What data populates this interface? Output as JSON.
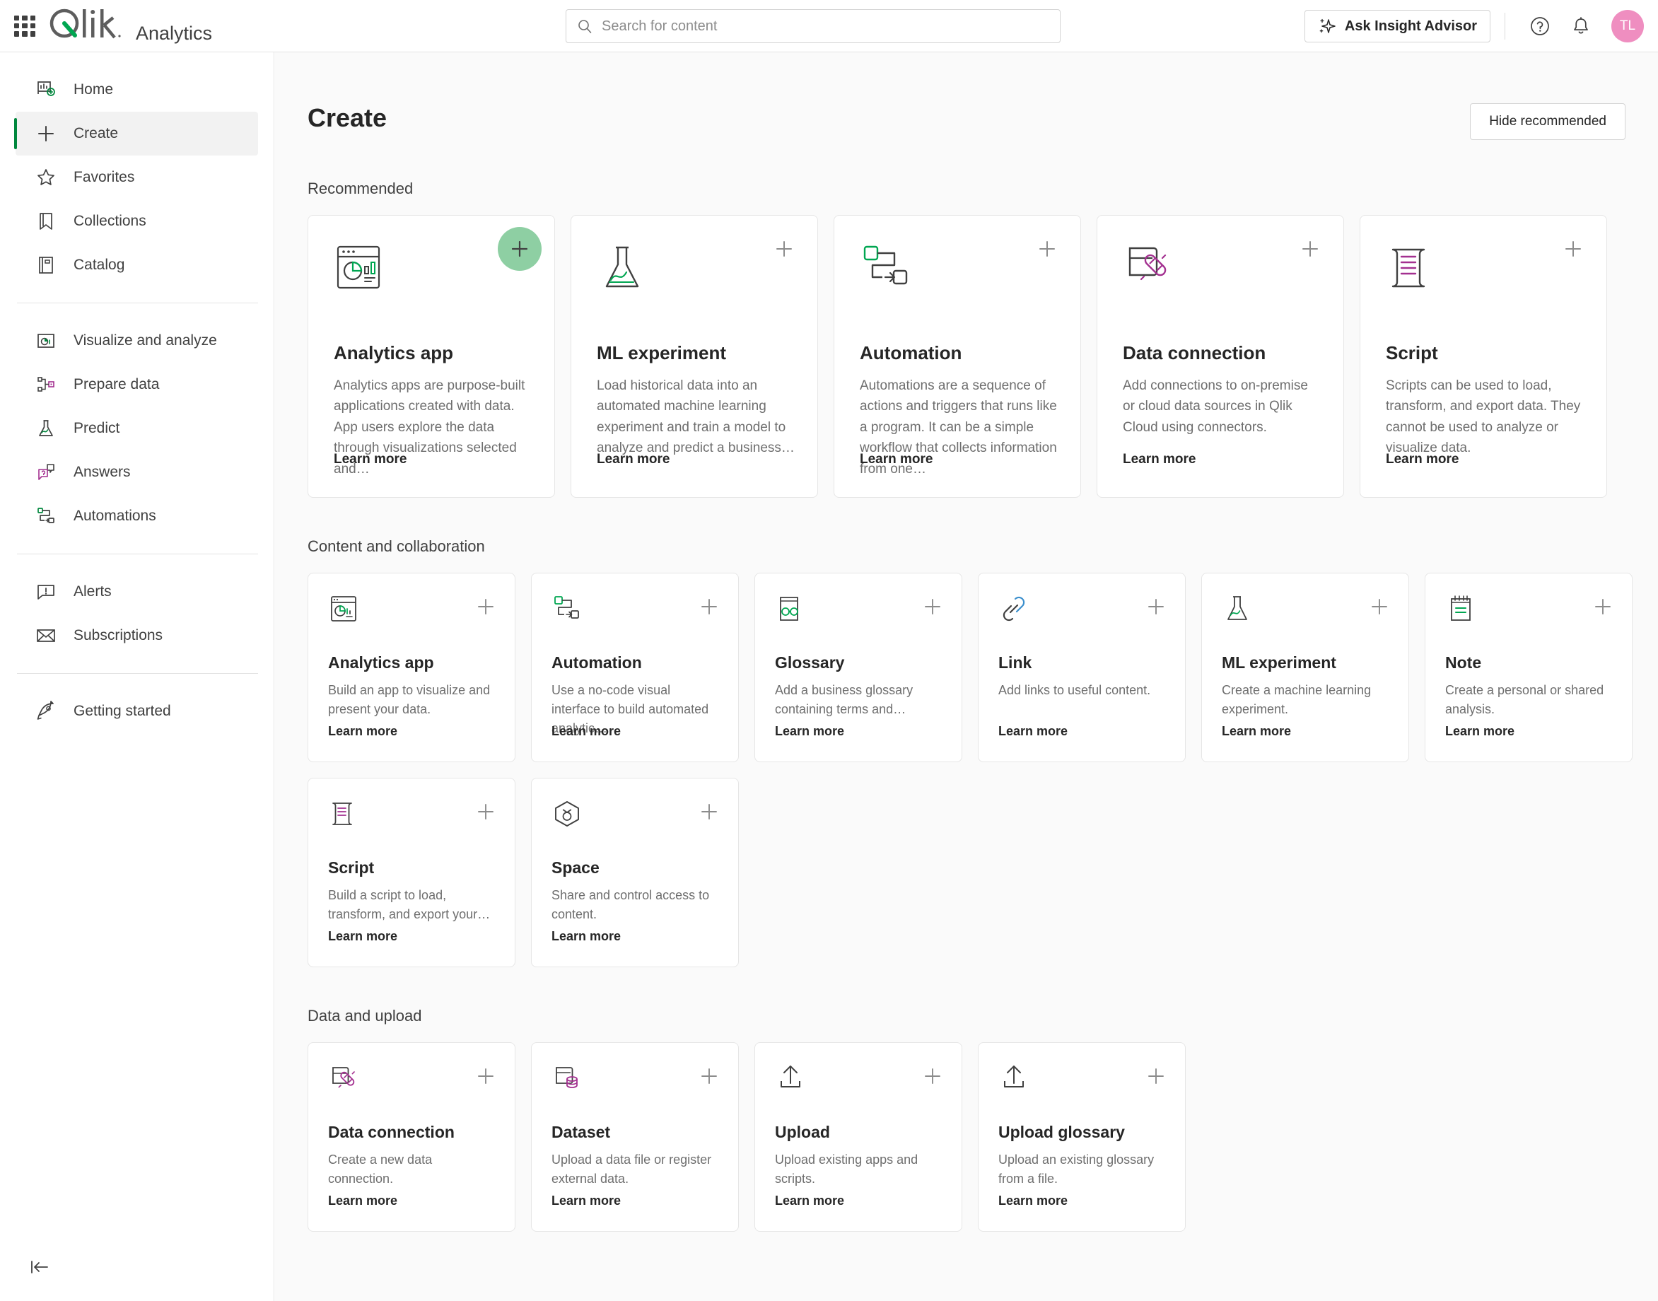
{
  "header": {
    "app_launcher_icon": "waffle-grid-icon",
    "logo_text": "Qlik",
    "product_name": "Analytics",
    "search": {
      "placeholder": "Search for content",
      "value": "",
      "icon": "search-icon"
    },
    "insight_advisor_label": "Ask Insight Advisor",
    "insight_advisor_icon": "sparkle-icon",
    "help_icon": "question-circle-icon",
    "notifications_icon": "bell-icon",
    "avatar_initials": "TL",
    "avatar_color": "#ef8ec0"
  },
  "sidebar": {
    "groups": [
      {
        "items": [
          {
            "label": "Home",
            "icon": "home-dashboard-icon",
            "active": false
          },
          {
            "label": "Create",
            "icon": "plus-icon",
            "active": true
          },
          {
            "label": "Favorites",
            "icon": "star-icon",
            "active": false
          },
          {
            "label": "Collections",
            "icon": "bookmark-icon",
            "active": false
          },
          {
            "label": "Catalog",
            "icon": "book-icon",
            "active": false
          }
        ]
      },
      {
        "items": [
          {
            "label": "Visualize and analyze",
            "icon": "chart-window-icon",
            "active": false
          },
          {
            "label": "Prepare data",
            "icon": "data-nodes-icon",
            "active": false
          },
          {
            "label": "Predict",
            "icon": "flask-icon",
            "active": false
          },
          {
            "label": "Answers",
            "icon": "chat-bubbles-icon",
            "active": false
          },
          {
            "label": "Automations",
            "icon": "automation-flow-icon",
            "active": false
          }
        ]
      },
      {
        "items": [
          {
            "label": "Alerts",
            "icon": "alert-bubble-icon",
            "active": false
          },
          {
            "label": "Subscriptions",
            "icon": "envelope-icon",
            "active": false
          }
        ]
      },
      {
        "items": [
          {
            "label": "Getting started",
            "icon": "rocket-icon",
            "active": false
          }
        ]
      }
    ],
    "collapse_icon": "collapse-left-icon"
  },
  "main": {
    "page_title": "Create",
    "hide_recommended_label": "Hide recommended",
    "learn_more_label": "Learn more",
    "sections": [
      {
        "title": "Recommended",
        "size": "large",
        "cards": [
          {
            "title": "Analytics app",
            "description": "Analytics apps are purpose-built applications created with data. App users explore the data through visualizations selected and…",
            "icon": "analytics-app-icon",
            "plus_hovered": true
          },
          {
            "title": "ML experiment",
            "description": "Load historical data into an automated machine learning experiment and train a model to analyze and predict a business…",
            "icon": "flask-icon",
            "plus_hovered": false
          },
          {
            "title": "Automation",
            "description": "Automations are a sequence of actions and triggers that runs like a program. It can be a simple workflow that collects information from one…",
            "icon": "automation-flow-icon",
            "plus_hovered": false
          },
          {
            "title": "Data connection",
            "description": "Add connections to on-premise or cloud data sources in Qlik Cloud using connectors.",
            "icon": "data-connection-icon",
            "plus_hovered": false
          },
          {
            "title": "Script",
            "description": "Scripts can be used to load, transform, and export data. They cannot be used to analyze or visualize data.",
            "icon": "script-scroll-icon",
            "plus_hovered": false
          }
        ]
      },
      {
        "title": "Content and collaboration",
        "size": "small",
        "cards": [
          {
            "title": "Analytics app",
            "description": "Build an app to visualize and present your data.",
            "icon": "analytics-app-icon"
          },
          {
            "title": "Automation",
            "description": "Use a no-code visual interface to build automated analytic…",
            "icon": "automation-flow-icon"
          },
          {
            "title": "Glossary",
            "description": "Add a business glossary containing terms and…",
            "icon": "glossary-icon"
          },
          {
            "title": "Link",
            "description": "Add links to useful content.",
            "icon": "link-chain-icon"
          },
          {
            "title": "ML experiment",
            "description": "Create a machine learning experiment.",
            "icon": "flask-icon"
          },
          {
            "title": "Note",
            "description": "Create a personal or shared analysis.",
            "icon": "note-pad-icon"
          },
          {
            "title": "Script",
            "description": "Build a script to load, transform, and export your…",
            "icon": "script-scroll-icon"
          },
          {
            "title": "Space",
            "description": "Share and control access to content.",
            "icon": "space-cube-icon"
          }
        ]
      },
      {
        "title": "Data and upload",
        "size": "small",
        "cards": [
          {
            "title": "Data connection",
            "description": "Create a new data connection.",
            "icon": "data-connection-icon"
          },
          {
            "title": "Dataset",
            "description": "Upload a data file or register external data.",
            "icon": "dataset-icon"
          },
          {
            "title": "Upload",
            "description": "Upload existing apps and scripts.",
            "icon": "upload-arrow-icon"
          },
          {
            "title": "Upload glossary",
            "description": "Upload an existing glossary from a file.",
            "icon": "upload-arrow-icon"
          }
        ]
      }
    ]
  },
  "colors": {
    "accent_green": "#00873d",
    "brand_green": "#00a651",
    "magenta": "#a33090",
    "link_blue": "#3b8fcd",
    "avatar_pink": "#ef8ec0",
    "plus_hover_green": "#8ecfa3"
  }
}
